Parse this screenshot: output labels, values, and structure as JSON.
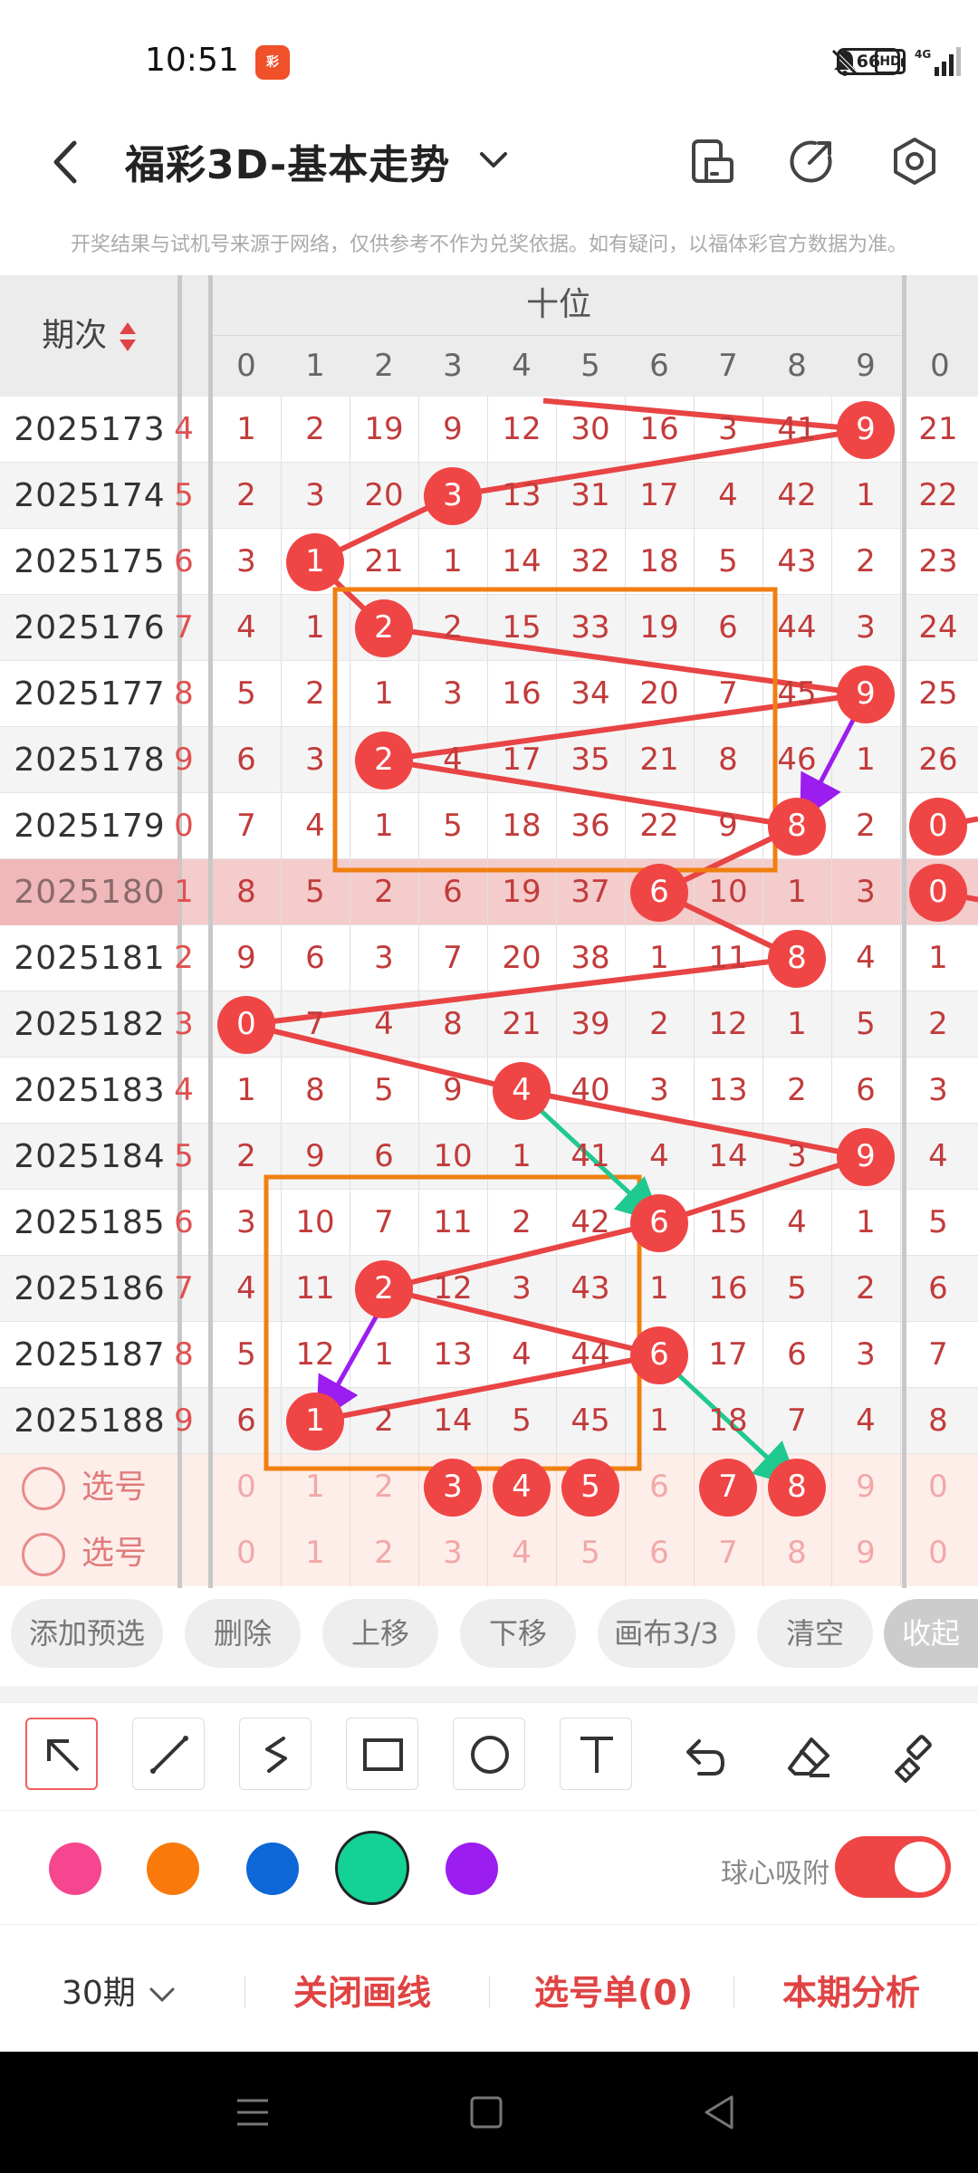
{
  "status": {
    "time": "10:51",
    "app_badge": "彩",
    "battery": "66",
    "network": "4G"
  },
  "header": {
    "title": "福彩3D-基本走势"
  },
  "disclaimer": "开奖结果与试机号来源于网络，仅供参考不作为兑奖依据。如有疑问，以福体彩官方数据为准。",
  "grid": {
    "period_header": "期次",
    "section_label": "十位",
    "digits": [
      "0",
      "1",
      "2",
      "3",
      "4",
      "5",
      "6",
      "7",
      "8",
      "9"
    ],
    "next_col_label": "0",
    "rows": [
      {
        "period": "2025173",
        "cells": [
          "1",
          "2",
          "19",
          "9",
          "12",
          "30",
          "16",
          "3",
          "41",
          "9"
        ],
        "ball": 9,
        "next": "21",
        "next_ball": false,
        "left": "4"
      },
      {
        "period": "2025174",
        "cells": [
          "2",
          "3",
          "20",
          "3",
          "13",
          "31",
          "17",
          "4",
          "42",
          "1"
        ],
        "ball": 3,
        "next": "22",
        "next_ball": false,
        "left": "5"
      },
      {
        "period": "2025175",
        "cells": [
          "3",
          "1",
          "21",
          "1",
          "14",
          "32",
          "18",
          "5",
          "43",
          "2"
        ],
        "ball": 1,
        "next": "23",
        "next_ball": false,
        "left": "6"
      },
      {
        "period": "2025176",
        "cells": [
          "4",
          "1",
          "2",
          "2",
          "15",
          "33",
          "19",
          "6",
          "44",
          "3"
        ],
        "ball": 2,
        "next": "24",
        "next_ball": false,
        "left": "7"
      },
      {
        "period": "2025177",
        "cells": [
          "5",
          "2",
          "1",
          "3",
          "16",
          "34",
          "20",
          "7",
          "45",
          "9"
        ],
        "ball": 9,
        "next": "25",
        "next_ball": false,
        "left": "8"
      },
      {
        "period": "2025178",
        "cells": [
          "6",
          "3",
          "2",
          "4",
          "17",
          "35",
          "21",
          "8",
          "46",
          "1"
        ],
        "ball": 2,
        "next": "26",
        "next_ball": false,
        "left": "9"
      },
      {
        "period": "2025179",
        "cells": [
          "7",
          "4",
          "1",
          "5",
          "18",
          "36",
          "22",
          "9",
          "8",
          "2"
        ],
        "ball": 8,
        "next": "0",
        "next_ball": true,
        "left": "0"
      },
      {
        "period": "2025180",
        "cells": [
          "8",
          "5",
          "2",
          "6",
          "19",
          "37",
          "6",
          "10",
          "1",
          "3"
        ],
        "ball": 6,
        "next": "0",
        "next_ball": true,
        "left": "1"
      },
      {
        "period": "2025181",
        "cells": [
          "9",
          "6",
          "3",
          "7",
          "20",
          "38",
          "1",
          "11",
          "8",
          "4"
        ],
        "ball": 8,
        "next": "1",
        "next_ball": false,
        "left": "2"
      },
      {
        "period": "2025182",
        "cells": [
          "0",
          "7",
          "4",
          "8",
          "21",
          "39",
          "2",
          "12",
          "1",
          "5"
        ],
        "ball": 0,
        "next": "2",
        "next_ball": false,
        "left": "3"
      },
      {
        "period": "2025183",
        "cells": [
          "1",
          "8",
          "5",
          "9",
          "4",
          "40",
          "3",
          "13",
          "2",
          "6"
        ],
        "ball": 4,
        "next": "3",
        "next_ball": false,
        "left": "4"
      },
      {
        "period": "2025184",
        "cells": [
          "2",
          "9",
          "6",
          "10",
          "1",
          "41",
          "4",
          "14",
          "3",
          "9"
        ],
        "ball": 9,
        "next": "4",
        "next_ball": false,
        "left": "5"
      },
      {
        "period": "2025185",
        "cells": [
          "3",
          "10",
          "7",
          "11",
          "2",
          "42",
          "6",
          "15",
          "4",
          "1"
        ],
        "ball": 6,
        "next": "5",
        "next_ball": false,
        "left": "6"
      },
      {
        "period": "2025186",
        "cells": [
          "4",
          "11",
          "2",
          "12",
          "3",
          "43",
          "1",
          "16",
          "5",
          "2"
        ],
        "ball": 2,
        "next": "6",
        "next_ball": false,
        "left": "7"
      },
      {
        "period": "2025187",
        "cells": [
          "5",
          "12",
          "1",
          "13",
          "4",
          "44",
          "6",
          "17",
          "6",
          "3"
        ],
        "ball": 6,
        "next": "7",
        "next_ball": false,
        "left": "8"
      },
      {
        "period": "2025188",
        "cells": [
          "6",
          "1",
          "2",
          "14",
          "5",
          "45",
          "1",
          "18",
          "7",
          "4"
        ],
        "ball": 1,
        "next": "8",
        "next_ball": false,
        "left": "9"
      }
    ],
    "pick_rows": [
      {
        "label": "选号",
        "cells": [
          "0",
          "1",
          "2",
          "3",
          "4",
          "5",
          "6",
          "7",
          "8",
          "9"
        ],
        "on": [
          3,
          4,
          5,
          7,
          8
        ],
        "next": "0"
      },
      {
        "label": "选号",
        "cells": [
          "0",
          "1",
          "2",
          "3",
          "4",
          "5",
          "6",
          "7",
          "8",
          "9"
        ],
        "on": [],
        "next": "0"
      }
    ],
    "colors": {
      "ball": "#f04545",
      "line": "#e84444",
      "box": "#f07f10",
      "arrow_purple": "#9b1df0",
      "arrow_green": "#1fc98f"
    }
  },
  "actions": {
    "add_preset": "添加预选",
    "delete": "删除",
    "move_up": "上移",
    "move_down": "下移",
    "canvas": "画布3/3",
    "clear": "清空",
    "collapse": "收起"
  },
  "tools": [
    "arrow-tool",
    "line-tool",
    "curve-tool",
    "rectangle-tool",
    "circle-tool",
    "text-tool",
    "undo-tool",
    "eraser-tool",
    "clear-brush-tool"
  ],
  "palette": {
    "colors": [
      "#f5468f",
      "#f97a0b",
      "#0e67d6",
      "#14d196",
      "#9b1df0"
    ],
    "selected": 3,
    "snap_label": "球心吸附",
    "snap_on": true
  },
  "bottom": {
    "period_select": "30期",
    "close_draw": "关闭画线",
    "pick_list": "选号单(0)",
    "analysis": "本期分析"
  }
}
